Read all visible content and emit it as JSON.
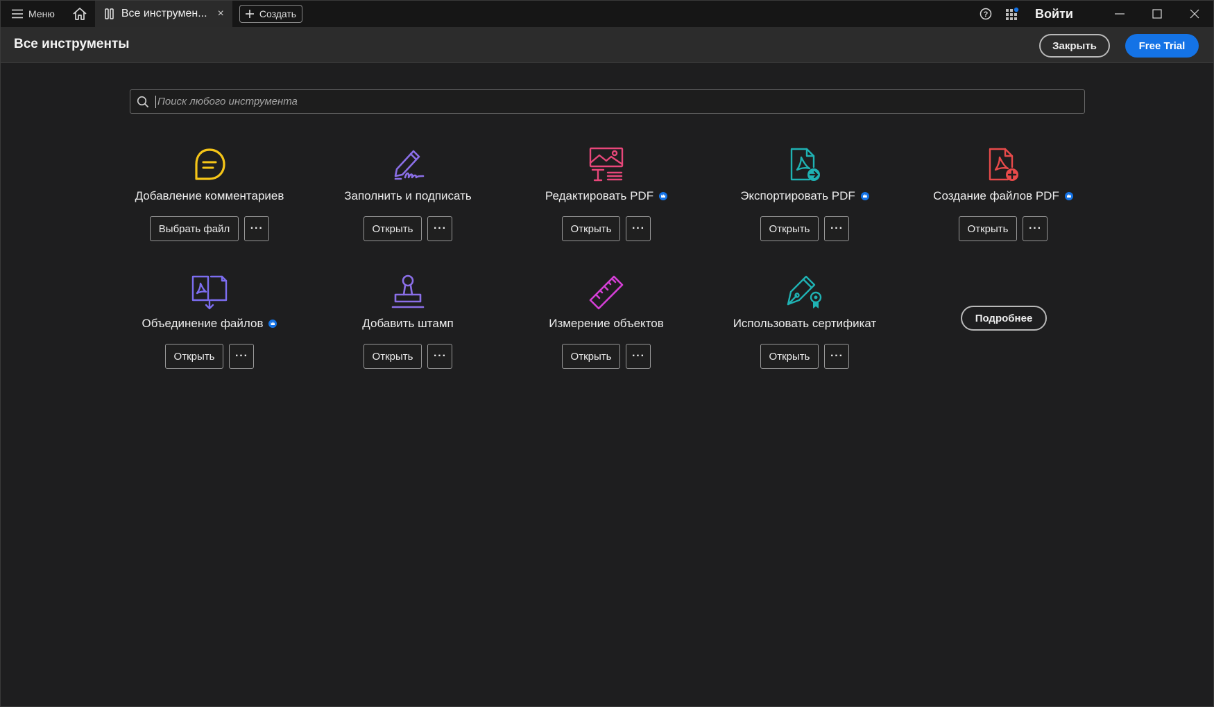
{
  "titlebar": {
    "menu_label": "Меню",
    "tab_label": "Все инструмен...",
    "tab_close": "×",
    "create_label": "Создать",
    "signin_label": "Войти",
    "icons": [
      "hamburger-icon",
      "home-icon",
      "document-icon",
      "plus-icon",
      "help-icon",
      "apps-icon",
      "minimize-icon",
      "maximize-icon",
      "close-icon"
    ]
  },
  "header": {
    "title": "Все инструменты",
    "close_label": "Закрыть",
    "trial_label": "Free Trial",
    "trial_color": "#1473e6"
  },
  "search": {
    "placeholder": "Поиск любого инструмента"
  },
  "more_label": "···",
  "tools": [
    {
      "name": "Добавление комментариев",
      "action": "Выбрать файл",
      "premium": false,
      "icon": "comment-icon",
      "color": "#f5c518"
    },
    {
      "name": "Заполнить и подписать",
      "action": "Открыть",
      "premium": false,
      "icon": "sign-pen-icon",
      "color": "#8b6fe8"
    },
    {
      "name": "Редактировать PDF",
      "action": "Открыть",
      "premium": true,
      "icon": "edit-pdf-icon",
      "color": "#e8477a"
    },
    {
      "name": "Экспортировать PDF",
      "action": "Открыть",
      "premium": true,
      "icon": "export-pdf-icon",
      "color": "#1fb2b3"
    },
    {
      "name": "Создание файлов PDF",
      "action": "Открыть",
      "premium": true,
      "icon": "create-pdf-icon",
      "color": "#e84a4a"
    },
    {
      "name": "Объединение файлов",
      "action": "Открыть",
      "premium": true,
      "icon": "combine-files-icon",
      "color": "#7c6df0"
    },
    {
      "name": "Добавить штамп",
      "action": "Открыть",
      "premium": false,
      "icon": "stamp-icon",
      "color": "#8b6fe8"
    },
    {
      "name": "Измерение объектов",
      "action": "Открыть",
      "premium": false,
      "icon": "ruler-icon",
      "color": "#d43fd6"
    },
    {
      "name": "Использовать сертификат",
      "action": "Открыть",
      "premium": false,
      "icon": "certificate-pen-icon",
      "color": "#1fb2b3"
    }
  ],
  "more_info_label": "Подробнее"
}
